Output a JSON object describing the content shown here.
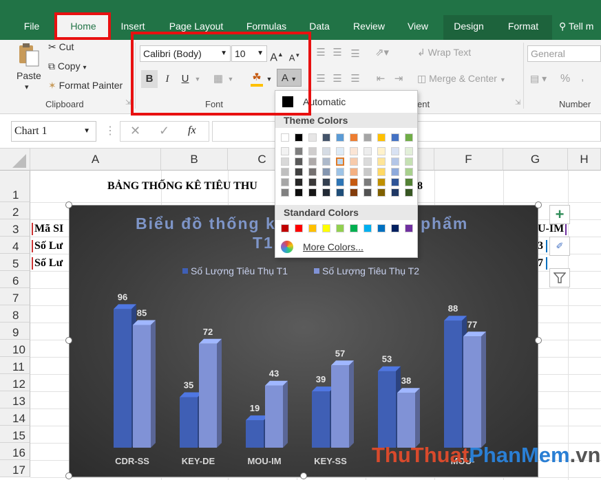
{
  "ribbon_tabs": [
    "File",
    "Home",
    "Insert",
    "Page Layout",
    "Formulas",
    "Data",
    "Review",
    "View",
    "Design",
    "Format",
    "Tell m"
  ],
  "active_tab": "Home",
  "clipboard": {
    "paste": "Paste",
    "cut": "Cut",
    "copy": "Copy",
    "format_painter": "Format Painter",
    "group": "Clipboard"
  },
  "font": {
    "name": "Calibri (Body)",
    "size": "10",
    "grow": "A",
    "shrink": "A",
    "bold": "B",
    "italic": "I",
    "underline": "U",
    "color_btn": "A",
    "group": "Font"
  },
  "alignment": {
    "wrap_text": "Wrap Text",
    "merge_center": "Merge & Center",
    "group_tail": "ent"
  },
  "number": {
    "format": "General",
    "percent": "%",
    "comma": ",",
    "group": "Number"
  },
  "name_box": "Chart 1",
  "fx": "fx",
  "columns": [
    "A",
    "B",
    "C",
    "D",
    "E",
    "F",
    "G",
    "H"
  ],
  "rows": [
    "1",
    "2",
    "3",
    "4",
    "5",
    "6",
    "7",
    "8",
    "9",
    "10",
    "11",
    "12",
    "13",
    "14",
    "15",
    "16",
    "17"
  ],
  "cells": {
    "title": "BẢNG THỐNG KÊ TIÊU THU",
    "title_tail": "8",
    "a3": "Mã SI",
    "a4": "Số Lư",
    "a5": "Số Lư",
    "g3": "U-IM",
    "g4": "3",
    "g5": "7"
  },
  "color_menu": {
    "automatic": "Automatic",
    "theme_title": "Theme Colors",
    "standard_title": "Standard Colors",
    "more": "More Colors...",
    "theme_top": [
      "#ffffff",
      "#000000",
      "#e7e6e6",
      "#44546a",
      "#5b9bd5",
      "#ed7d31",
      "#a5a5a5",
      "#ffc000",
      "#4472c4",
      "#70ad47"
    ],
    "theme_cols": [
      [
        "#f2f2f2",
        "#d9d9d9",
        "#bfbfbf",
        "#a6a6a6",
        "#808080"
      ],
      [
        "#7f7f7f",
        "#595959",
        "#404040",
        "#262626",
        "#0d0d0d"
      ],
      [
        "#d0cece",
        "#aeaaaa",
        "#757171",
        "#3a3838",
        "#171616"
      ],
      [
        "#d6dce4",
        "#adb9ca",
        "#8496b0",
        "#333f4f",
        "#222a35"
      ],
      [
        "#deebf6",
        "#bdd7ee",
        "#9dc3e6",
        "#2e75b5",
        "#1f4e79"
      ],
      [
        "#fbe5d5",
        "#f7cbac",
        "#f4b183",
        "#c55a11",
        "#833c0b"
      ],
      [
        "#ededed",
        "#dbdbdb",
        "#c9c9c9",
        "#7b7b7b",
        "#525252"
      ],
      [
        "#fff2cc",
        "#fee599",
        "#ffd965",
        "#bf9000",
        "#7f6000"
      ],
      [
        "#d9e2f3",
        "#b4c6e7",
        "#8eaadb",
        "#2f5496",
        "#1f3864"
      ],
      [
        "#e2efd9",
        "#c5e0b3",
        "#a8d08d",
        "#538135",
        "#375623"
      ]
    ],
    "standard": [
      "#c00000",
      "#ff0000",
      "#ffc000",
      "#ffff00",
      "#92d050",
      "#00b050",
      "#00b0f0",
      "#0070c0",
      "#002060",
      "#7030a0"
    ]
  },
  "watermark": {
    "part1": "ThuThuat",
    "part2": "PhanMem",
    "part3": ".vn"
  },
  "chart_data": {
    "type": "bar",
    "title": "Biểu đồ thống kê tiêu thụ sản phẩm T1-T2",
    "title_visible_left": "Biểu đồ thống k",
    "title_visible_right": "phẩm",
    "title_line2": "T1",
    "categories": [
      "CDR-SS",
      "KEY-DE",
      "MOU-IM",
      "KEY-SS",
      "",
      "MOU-"
    ],
    "series": [
      {
        "name": "Số Lượng Tiêu Thụ T1",
        "values": [
          96,
          35,
          19,
          39,
          53,
          88
        ],
        "color": "#3f5fb5"
      },
      {
        "name": "Số Lượng Tiêu Thụ T2",
        "values": [
          85,
          72,
          43,
          57,
          38,
          77
        ],
        "color": "#8092d6"
      }
    ],
    "ylim": [
      0,
      100
    ],
    "grid": false,
    "legend": "top"
  }
}
